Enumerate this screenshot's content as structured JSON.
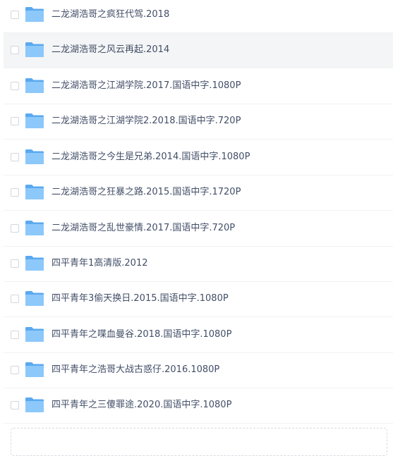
{
  "files": [
    {
      "name": "二龙湖浩哥之疯狂代驾.2018",
      "icon": "folder-icon"
    },
    {
      "name": "二龙湖浩哥之风云再起.2014",
      "icon": "folder-icon"
    },
    {
      "name": "二龙湖浩哥之江湖学院.2017.国语中字.1080P",
      "icon": "folder-icon"
    },
    {
      "name": "二龙湖浩哥之江湖学院2.2018.国语中字.720P",
      "icon": "folder-icon"
    },
    {
      "name": "二龙湖浩哥之今生是兄弟.2014.国语中字.1080P",
      "icon": "folder-icon"
    },
    {
      "name": "二龙湖浩哥之狂暴之路.2015.国语中字.1720P",
      "icon": "folder-icon"
    },
    {
      "name": "二龙湖浩哥之乱世豪情.2017.国语中字.720P",
      "icon": "folder-icon"
    },
    {
      "name": "四平青年1高清版.2012",
      "icon": "folder-icon"
    },
    {
      "name": "四平青年3偷天换日.2015.国语中字.1080P",
      "icon": "folder-icon"
    },
    {
      "name": "四平青年之喋血曼谷.2018.国语中字.1080P",
      "icon": "folder-icon"
    },
    {
      "name": "四平青年之浩哥大战古惑仔.2016.1080P",
      "icon": "folder-icon"
    },
    {
      "name": "四平青年之三傻罪途.2020.国语中字.1080P",
      "icon": "folder-icon"
    }
  ],
  "colors": {
    "folder_back": "#5aa9f0",
    "folder_front": "#8cc8fa",
    "text": "#424e67",
    "hover_row": "#f4f5f6"
  }
}
